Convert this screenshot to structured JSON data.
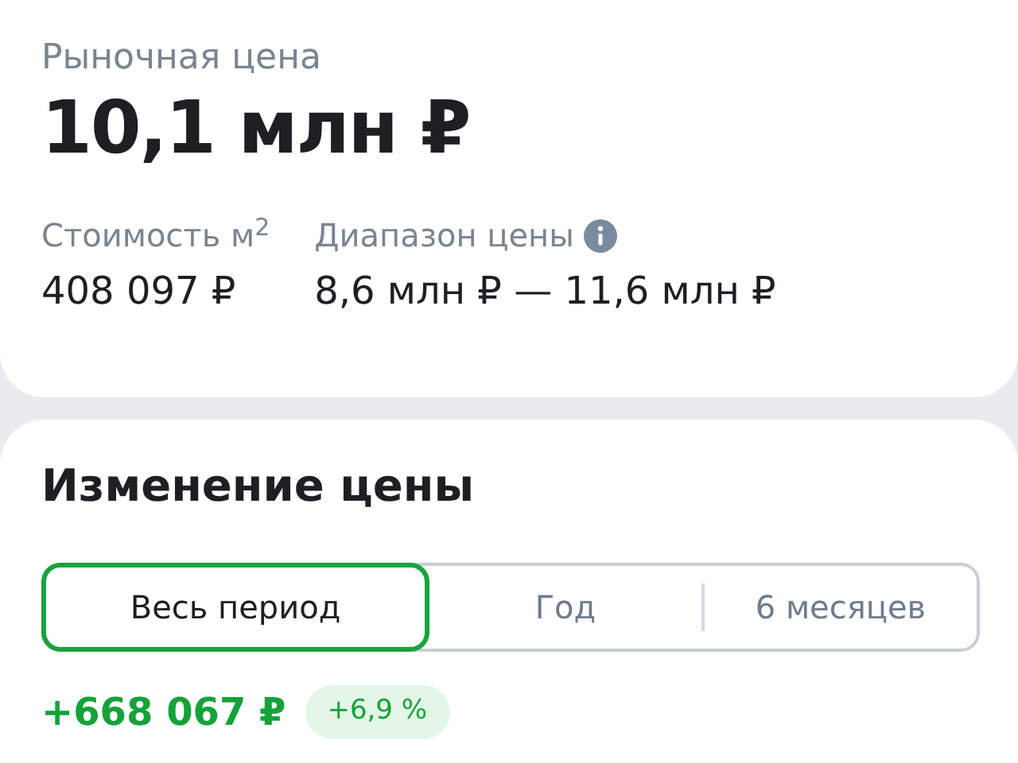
{
  "market_price": {
    "label": "Рыночная цена",
    "value": "10,1 млн ₽"
  },
  "stats": [
    {
      "label": "Стоимость м$^{2}$",
      "value": "408 097 ₽",
      "info": false
    },
    {
      "label": "Диапазон цены",
      "value": "8,6 млн ₽ — 11,6 млн ₽",
      "info": true
    }
  ],
  "price_change": {
    "title": "Изменение цены",
    "tabs": [
      {
        "label": "Весь период",
        "selected": true
      },
      {
        "label": "Год",
        "selected": false
      },
      {
        "label": "6 месяцев",
        "selected": false
      }
    ],
    "change": "+668 067 ₽",
    "change_percent": "+6,9 %"
  }
}
